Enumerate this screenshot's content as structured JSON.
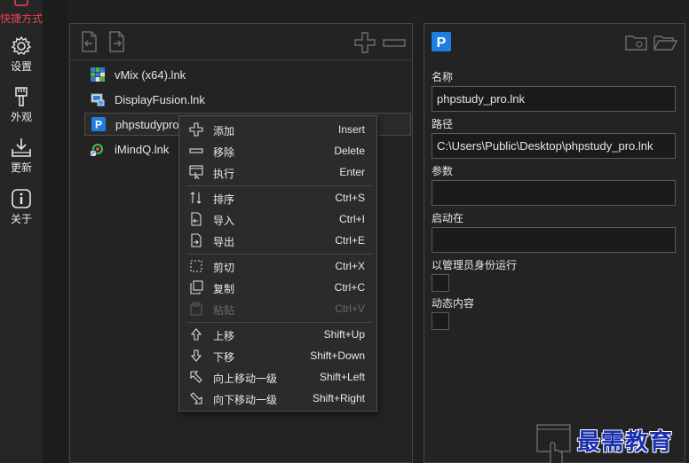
{
  "nav": {
    "items": [
      {
        "label": "快捷方式",
        "icon": "shortcut-icon",
        "active": true
      },
      {
        "label": "设置",
        "icon": "gear-icon"
      },
      {
        "label": "外观",
        "icon": "brush-icon"
      },
      {
        "label": "更新",
        "icon": "download-icon"
      },
      {
        "label": "关于",
        "icon": "info-icon"
      }
    ],
    "active_color": "#e8424f"
  },
  "list": {
    "items": [
      {
        "label": "vMix (x64).lnk",
        "icon": "vmix-icon"
      },
      {
        "label": "DisplayFusion.lnk",
        "icon": "displayfusion-icon"
      },
      {
        "label": "phpstudy_pro.lnk",
        "label_visible": "phpstudypro",
        "icon": "phpstudy-icon",
        "selected": true
      },
      {
        "label": "iMindQ.lnk",
        "icon": "imindq-icon"
      }
    ]
  },
  "details": {
    "name_label": "名称",
    "name_value": "phpstudy_pro.lnk",
    "path_label": "路径",
    "path_value": "C:\\Users\\Public\\Desktop\\phpstudy_pro.lnk",
    "args_label": "参数",
    "args_value": "",
    "startin_label": "启动在",
    "startin_value": "",
    "admin_label": "以管理员身份运行",
    "dynamic_label": "动态内容"
  },
  "context_menu": {
    "items": [
      {
        "label": "添加",
        "shortcut": "Insert",
        "icon": "plus-icon"
      },
      {
        "label": "移除",
        "shortcut": "Delete",
        "icon": "minus-icon"
      },
      {
        "label": "执行",
        "shortcut": "Enter",
        "icon": "run-icon"
      },
      {
        "label": "排序",
        "shortcut": "Ctrl+S",
        "icon": "sort-icon"
      },
      {
        "label": "导入",
        "shortcut": "Ctrl+I",
        "icon": "import-icon"
      },
      {
        "label": "导出",
        "shortcut": "Ctrl+E",
        "icon": "export-icon"
      },
      {
        "label": "剪切",
        "shortcut": "Ctrl+X",
        "icon": "cut-icon"
      },
      {
        "label": "复制",
        "shortcut": "Ctrl+C",
        "icon": "copy-icon"
      },
      {
        "label": "粘贴",
        "shortcut": "Ctrl+V",
        "icon": "paste-icon",
        "disabled": true
      },
      {
        "label": "上移",
        "shortcut": "Shift+Up",
        "icon": "arrow-up-icon"
      },
      {
        "label": "下移",
        "shortcut": "Shift+Down",
        "icon": "arrow-down-icon"
      },
      {
        "label": "向上移动一级",
        "shortcut": "Shift+Left",
        "icon": "arrow-up-left-icon"
      },
      {
        "label": "向下移动一级",
        "shortcut": "Shift+Right",
        "icon": "arrow-down-right-icon"
      }
    ]
  },
  "watermark": {
    "text": "最需教育"
  }
}
